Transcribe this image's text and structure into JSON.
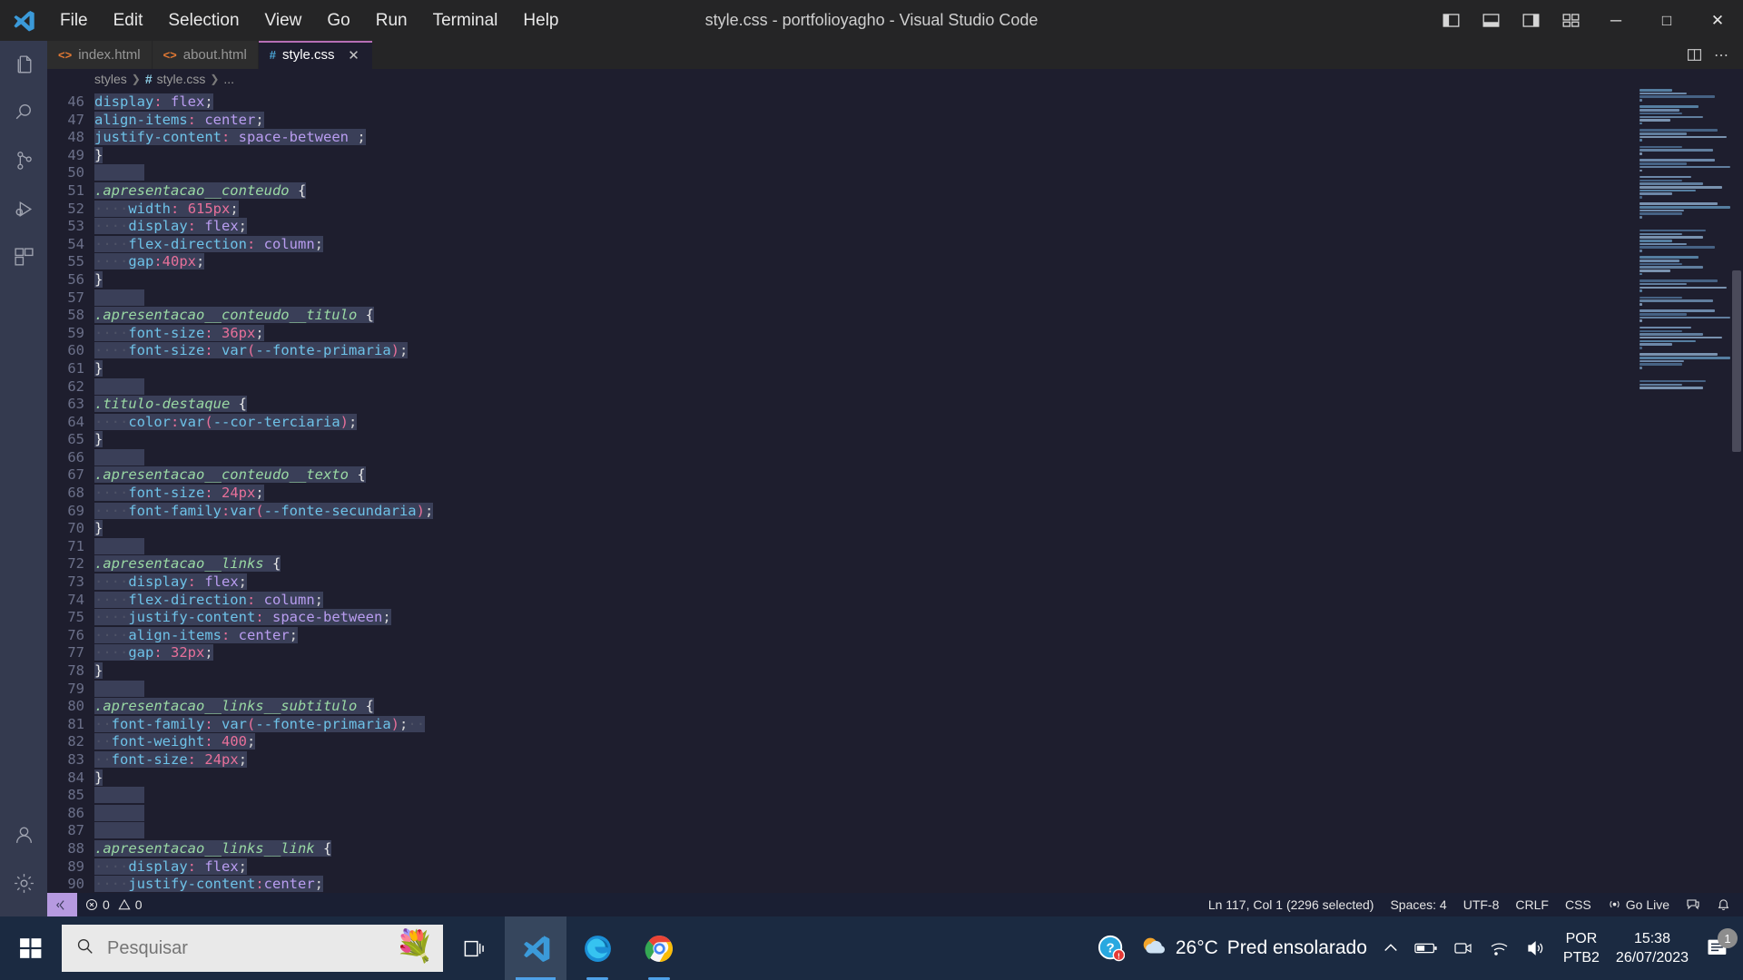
{
  "window": {
    "title": "style.css - portfolioyagho - Visual Studio Code",
    "minimize": "─",
    "maximize": "□",
    "close": "✕"
  },
  "menu": [
    "File",
    "Edit",
    "Selection",
    "View",
    "Go",
    "Run",
    "Terminal",
    "Help"
  ],
  "activity_bar": [
    {
      "name": "explorer-icon",
      "label": "Explorer"
    },
    {
      "name": "search-icon",
      "label": "Search"
    },
    {
      "name": "source-control-icon",
      "label": "Source Control"
    },
    {
      "name": "run-debug-icon",
      "label": "Run and Debug"
    },
    {
      "name": "extensions-icon",
      "label": "Extensions"
    },
    {
      "name": "accounts-icon",
      "label": "Accounts"
    },
    {
      "name": "settings-gear-icon",
      "label": "Manage"
    }
  ],
  "tabs": [
    {
      "label": "index.html",
      "icon": "html-icon",
      "active": false,
      "closable": false
    },
    {
      "label": "about.html",
      "icon": "html-icon",
      "active": false,
      "closable": false
    },
    {
      "label": "style.css",
      "icon": "css-icon",
      "active": true,
      "closable": true,
      "close": "✕"
    }
  ],
  "breadcrumb": [
    "styles",
    "style.css",
    "..."
  ],
  "editor": {
    "first_line": 46,
    "lines": [
      {
        "n": 46,
        "tokens": [
          {
            "t": "display",
            "c": "prop"
          },
          {
            "t": ":",
            "c": "colon"
          },
          {
            "t": " ",
            "c": "ws"
          },
          {
            "t": "flex",
            "c": "val"
          },
          {
            "t": ";",
            "c": "punc"
          }
        ],
        "sel": true
      },
      {
        "n": 47,
        "tokens": [
          {
            "t": "align-items",
            "c": "prop"
          },
          {
            "t": ":",
            "c": "colon"
          },
          {
            "t": " ",
            "c": "ws"
          },
          {
            "t": "center",
            "c": "val"
          },
          {
            "t": ";",
            "c": "punc"
          }
        ],
        "sel": true
      },
      {
        "n": 48,
        "tokens": [
          {
            "t": "justify-content",
            "c": "prop"
          },
          {
            "t": ":",
            "c": "colon"
          },
          {
            "t": " ",
            "c": "ws"
          },
          {
            "t": "space-between",
            "c": "val"
          },
          {
            "t": " ",
            "c": "ws"
          },
          {
            "t": ";",
            "c": "punc"
          }
        ],
        "sel": true
      },
      {
        "n": 49,
        "tokens": [
          {
            "t": "}",
            "c": "brace"
          }
        ],
        "sel": true
      },
      {
        "n": 50,
        "tokens": [],
        "sel": true
      },
      {
        "n": 51,
        "tokens": [
          {
            "t": ".apresentacao__conteudo",
            "c": "sel"
          },
          {
            "t": " ",
            "c": "ws"
          },
          {
            "t": "{",
            "c": "brace"
          }
        ],
        "sel": true
      },
      {
        "n": 52,
        "tokens": [
          {
            "t": "····",
            "c": "ws"
          },
          {
            "t": "width",
            "c": "prop"
          },
          {
            "t": ":",
            "c": "colon"
          },
          {
            "t": " ",
            "c": "ws"
          },
          {
            "t": "615px",
            "c": "num"
          },
          {
            "t": ";",
            "c": "punc"
          }
        ],
        "sel": true
      },
      {
        "n": 53,
        "tokens": [
          {
            "t": "····",
            "c": "ws"
          },
          {
            "t": "display",
            "c": "prop"
          },
          {
            "t": ":",
            "c": "colon"
          },
          {
            "t": " ",
            "c": "ws"
          },
          {
            "t": "flex",
            "c": "val"
          },
          {
            "t": ";",
            "c": "punc"
          }
        ],
        "sel": true
      },
      {
        "n": 54,
        "tokens": [
          {
            "t": "····",
            "c": "ws"
          },
          {
            "t": "flex-direction",
            "c": "prop"
          },
          {
            "t": ":",
            "c": "colon"
          },
          {
            "t": " ",
            "c": "ws"
          },
          {
            "t": "column",
            "c": "val"
          },
          {
            "t": ";",
            "c": "punc"
          }
        ],
        "sel": true
      },
      {
        "n": 55,
        "tokens": [
          {
            "t": "····",
            "c": "ws"
          },
          {
            "t": "gap",
            "c": "prop"
          },
          {
            "t": ":",
            "c": "colon"
          },
          {
            "t": "40px",
            "c": "num"
          },
          {
            "t": ";",
            "c": "punc"
          }
        ],
        "sel": true
      },
      {
        "n": 56,
        "tokens": [
          {
            "t": "}",
            "c": "brace"
          }
        ],
        "sel": true
      },
      {
        "n": 57,
        "tokens": [],
        "sel": true
      },
      {
        "n": 58,
        "tokens": [
          {
            "t": ".apresentacao__conteudo__titulo",
            "c": "sel"
          },
          {
            "t": " ",
            "c": "ws"
          },
          {
            "t": "{",
            "c": "brace"
          }
        ],
        "sel": true
      },
      {
        "n": 59,
        "tokens": [
          {
            "t": "····",
            "c": "ws"
          },
          {
            "t": "font-size",
            "c": "prop"
          },
          {
            "t": ":",
            "c": "colon"
          },
          {
            "t": " ",
            "c": "ws"
          },
          {
            "t": "36px",
            "c": "num"
          },
          {
            "t": ";",
            "c": "punc"
          }
        ],
        "sel": true
      },
      {
        "n": 60,
        "tokens": [
          {
            "t": "····",
            "c": "ws"
          },
          {
            "t": "font-size",
            "c": "prop"
          },
          {
            "t": ":",
            "c": "colon"
          },
          {
            "t": " ",
            "c": "ws"
          },
          {
            "t": "var",
            "c": "fn"
          },
          {
            "t": "(",
            "c": "paren"
          },
          {
            "t": "--fonte-primaria",
            "c": "varx"
          },
          {
            "t": ")",
            "c": "paren"
          },
          {
            "t": ";",
            "c": "punc"
          }
        ],
        "sel": true
      },
      {
        "n": 61,
        "tokens": [
          {
            "t": "}",
            "c": "brace"
          }
        ],
        "sel": true
      },
      {
        "n": 62,
        "tokens": [],
        "sel": true
      },
      {
        "n": 63,
        "tokens": [
          {
            "t": ".titulo-destaque",
            "c": "sel"
          },
          {
            "t": " ",
            "c": "ws"
          },
          {
            "t": "{",
            "c": "brace"
          }
        ],
        "sel": true
      },
      {
        "n": 64,
        "tokens": [
          {
            "t": "····",
            "c": "ws"
          },
          {
            "t": "color",
            "c": "prop"
          },
          {
            "t": ":",
            "c": "colon"
          },
          {
            "t": "var",
            "c": "fn"
          },
          {
            "t": "(",
            "c": "paren"
          },
          {
            "t": "--cor-terciaria",
            "c": "varx"
          },
          {
            "t": ")",
            "c": "paren"
          },
          {
            "t": ";",
            "c": "punc"
          }
        ],
        "sel": true
      },
      {
        "n": 65,
        "tokens": [
          {
            "t": "}",
            "c": "brace"
          }
        ],
        "sel": true
      },
      {
        "n": 66,
        "tokens": [],
        "sel": true
      },
      {
        "n": 67,
        "tokens": [
          {
            "t": ".apresentacao__conteudo__texto",
            "c": "sel"
          },
          {
            "t": " ",
            "c": "ws"
          },
          {
            "t": "{",
            "c": "brace"
          }
        ],
        "sel": true
      },
      {
        "n": 68,
        "tokens": [
          {
            "t": "····",
            "c": "ws"
          },
          {
            "t": "font-size",
            "c": "prop"
          },
          {
            "t": ":",
            "c": "colon"
          },
          {
            "t": " ",
            "c": "ws"
          },
          {
            "t": "24px",
            "c": "num"
          },
          {
            "t": ";",
            "c": "punc"
          }
        ],
        "sel": true
      },
      {
        "n": 69,
        "tokens": [
          {
            "t": "····",
            "c": "ws"
          },
          {
            "t": "font-family",
            "c": "prop"
          },
          {
            "t": ":",
            "c": "colon"
          },
          {
            "t": "var",
            "c": "fn"
          },
          {
            "t": "(",
            "c": "paren"
          },
          {
            "t": "--fonte-secundaria",
            "c": "varx"
          },
          {
            "t": ")",
            "c": "paren"
          },
          {
            "t": ";",
            "c": "punc"
          }
        ],
        "sel": true
      },
      {
        "n": 70,
        "tokens": [
          {
            "t": "}",
            "c": "brace"
          }
        ],
        "sel": true
      },
      {
        "n": 71,
        "tokens": [],
        "sel": true
      },
      {
        "n": 72,
        "tokens": [
          {
            "t": ".apresentacao__links",
            "c": "sel"
          },
          {
            "t": " ",
            "c": "ws"
          },
          {
            "t": "{",
            "c": "brace"
          }
        ],
        "sel": true
      },
      {
        "n": 73,
        "tokens": [
          {
            "t": "····",
            "c": "ws"
          },
          {
            "t": "display",
            "c": "prop"
          },
          {
            "t": ":",
            "c": "colon"
          },
          {
            "t": " ",
            "c": "ws"
          },
          {
            "t": "flex",
            "c": "val"
          },
          {
            "t": ";",
            "c": "punc"
          }
        ],
        "sel": true
      },
      {
        "n": 74,
        "tokens": [
          {
            "t": "····",
            "c": "ws"
          },
          {
            "t": "flex-direction",
            "c": "prop"
          },
          {
            "t": ":",
            "c": "colon"
          },
          {
            "t": " ",
            "c": "ws"
          },
          {
            "t": "column",
            "c": "val"
          },
          {
            "t": ";",
            "c": "punc"
          }
        ],
        "sel": true
      },
      {
        "n": 75,
        "tokens": [
          {
            "t": "····",
            "c": "ws"
          },
          {
            "t": "justify-content",
            "c": "prop"
          },
          {
            "t": ":",
            "c": "colon"
          },
          {
            "t": " ",
            "c": "ws"
          },
          {
            "t": "space-between",
            "c": "val"
          },
          {
            "t": ";",
            "c": "punc"
          }
        ],
        "sel": true
      },
      {
        "n": 76,
        "tokens": [
          {
            "t": "····",
            "c": "ws"
          },
          {
            "t": "align-items",
            "c": "prop"
          },
          {
            "t": ":",
            "c": "colon"
          },
          {
            "t": " ",
            "c": "ws"
          },
          {
            "t": "center",
            "c": "val"
          },
          {
            "t": ";",
            "c": "punc"
          }
        ],
        "sel": true
      },
      {
        "n": 77,
        "tokens": [
          {
            "t": "····",
            "c": "ws"
          },
          {
            "t": "gap",
            "c": "prop"
          },
          {
            "t": ":",
            "c": "colon"
          },
          {
            "t": " ",
            "c": "ws"
          },
          {
            "t": "32px",
            "c": "num"
          },
          {
            "t": ";",
            "c": "punc"
          }
        ],
        "sel": true
      },
      {
        "n": 78,
        "tokens": [
          {
            "t": "}",
            "c": "brace"
          }
        ],
        "sel": true
      },
      {
        "n": 79,
        "tokens": [],
        "sel": true
      },
      {
        "n": 80,
        "tokens": [
          {
            "t": ".apresentacao__links__subtitulo",
            "c": "sel"
          },
          {
            "t": " ",
            "c": "ws"
          },
          {
            "t": "{",
            "c": "brace"
          }
        ],
        "sel": true
      },
      {
        "n": 81,
        "tokens": [
          {
            "t": "··",
            "c": "ws"
          },
          {
            "t": "font-family",
            "c": "prop"
          },
          {
            "t": ":",
            "c": "colon"
          },
          {
            "t": " ",
            "c": "ws"
          },
          {
            "t": "var",
            "c": "fn"
          },
          {
            "t": "(",
            "c": "paren"
          },
          {
            "t": "--fonte-primaria",
            "c": "varx"
          },
          {
            "t": ")",
            "c": "paren"
          },
          {
            "t": ";",
            "c": "punc"
          },
          {
            "t": "··",
            "c": "ws"
          }
        ],
        "sel": true
      },
      {
        "n": 82,
        "tokens": [
          {
            "t": "··",
            "c": "ws"
          },
          {
            "t": "font-weight",
            "c": "prop"
          },
          {
            "t": ":",
            "c": "colon"
          },
          {
            "t": " ",
            "c": "ws"
          },
          {
            "t": "400",
            "c": "num"
          },
          {
            "t": ";",
            "c": "punc"
          }
        ],
        "sel": true
      },
      {
        "n": 83,
        "tokens": [
          {
            "t": "··",
            "c": "ws"
          },
          {
            "t": "font-size",
            "c": "prop"
          },
          {
            "t": ":",
            "c": "colon"
          },
          {
            "t": " ",
            "c": "ws"
          },
          {
            "t": "24px",
            "c": "num"
          },
          {
            "t": ";",
            "c": "punc"
          }
        ],
        "sel": true
      },
      {
        "n": 84,
        "tokens": [
          {
            "t": "}",
            "c": "brace"
          }
        ],
        "sel": true
      },
      {
        "n": 85,
        "tokens": [],
        "sel": true
      },
      {
        "n": 86,
        "tokens": [],
        "sel": true
      },
      {
        "n": 87,
        "tokens": [],
        "sel": true
      },
      {
        "n": 88,
        "tokens": [
          {
            "t": ".apresentacao__links__link",
            "c": "sel"
          },
          {
            "t": " ",
            "c": "ws"
          },
          {
            "t": "{",
            "c": "brace"
          }
        ],
        "sel": true
      },
      {
        "n": 89,
        "tokens": [
          {
            "t": "····",
            "c": "ws"
          },
          {
            "t": "display",
            "c": "prop"
          },
          {
            "t": ":",
            "c": "colon"
          },
          {
            "t": " ",
            "c": "ws"
          },
          {
            "t": "flex",
            "c": "val"
          },
          {
            "t": ";",
            "c": "punc"
          }
        ],
        "sel": true
      },
      {
        "n": 90,
        "tokens": [
          {
            "t": "····",
            "c": "ws"
          },
          {
            "t": "justify-content",
            "c": "prop"
          },
          {
            "t": ":",
            "c": "colon"
          },
          {
            "t": "center",
            "c": "val"
          },
          {
            "t": ";",
            "c": "punc"
          }
        ],
        "sel": true
      }
    ]
  },
  "status_bar": {
    "remote_label": "⧠‹",
    "errors": "0",
    "warnings": "0",
    "cursor": "Ln 117, Col 1 (2296 selected)",
    "indent": "Spaces: 4",
    "encoding": "UTF-8",
    "eol": "CRLF",
    "language": "CSS",
    "go_live": "Go Live",
    "feedback_icon": "feedback-icon",
    "bell_icon": "bell-icon"
  },
  "taskbar": {
    "search_placeholder": "Pesquisar",
    "search_value": "",
    "apps": [
      {
        "name": "task-view-icon",
        "label": "Task View"
      },
      {
        "name": "vscode-icon",
        "label": "Visual Studio Code"
      },
      {
        "name": "edge-icon",
        "label": "Microsoft Edge"
      },
      {
        "name": "chrome-icon",
        "label": "Google Chrome"
      }
    ],
    "help_label": "Help",
    "weather_temp": "26°C",
    "weather_text": "Pred ensolarado",
    "lang_top": "POR",
    "lang_bottom": "PTB2",
    "time": "15:38",
    "date": "26/07/2023",
    "notification_count": "1"
  },
  "colors": {
    "accent": "#b66eb5",
    "selection": "#3a3f58",
    "editor_bg": "#1e1e2e",
    "activity_bg": "#343a4f",
    "status_bg": "#1a1f33",
    "taskbar_bg": "#1b2a41"
  }
}
